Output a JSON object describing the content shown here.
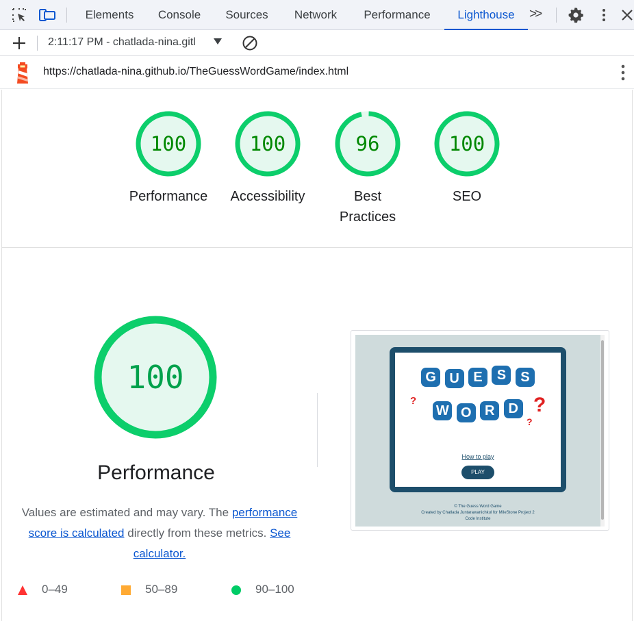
{
  "devtools": {
    "tabs": [
      {
        "label": "Elements"
      },
      {
        "label": "Console"
      },
      {
        "label": "Sources"
      },
      {
        "label": "Network"
      },
      {
        "label": "Performance"
      },
      {
        "label": "Lighthouse",
        "active": true
      }
    ],
    "more_tabs_label": ">>",
    "icons": [
      "inspect-element-icon",
      "device-toolbar-icon",
      "gear-icon",
      "kebab-menu-icon",
      "close-icon"
    ]
  },
  "toolbar": {
    "report_select": "2:11:17 PM - chatlada-nina.gitl",
    "icons": [
      "add-icon",
      "clear-icon"
    ]
  },
  "urlbar": {
    "url": "https://chatlada-nina.github.io/TheGuessWordGame/index.html",
    "icons": [
      "lighthouse-icon",
      "kebab-menu-icon"
    ]
  },
  "scores": [
    {
      "label": "Performance",
      "value": "100",
      "fraction": 1.0
    },
    {
      "label": "Accessibility",
      "value": "100",
      "fraction": 1.0
    },
    {
      "label": "Best Practices",
      "value": "96",
      "fraction": 0.96
    },
    {
      "label": "SEO",
      "value": "100",
      "fraction": 1.0
    }
  ],
  "performance": {
    "score": "100",
    "fraction": 1.0,
    "title": "Performance",
    "desc_prefix": "Values are estimated and may vary. The ",
    "link_score": "performance score is calculated",
    "desc_middle": " directly from these metrics. ",
    "link_calc": "See calculator."
  },
  "legend": [
    {
      "range": "0–49",
      "shape": "triangle",
      "color": "#ff3333"
    },
    {
      "range": "50–89",
      "shape": "square",
      "color": "#ffaa33"
    },
    {
      "range": "90–100",
      "shape": "circle",
      "color": "#00cc66"
    }
  ],
  "colors": {
    "pass": "#0cce6b",
    "pass_fill": "#e5f8ef",
    "pass_text": "#008800",
    "link": "#0b57d0"
  },
  "screenshot": {
    "tiles_row1": [
      "G",
      "U",
      "E",
      "S",
      "S"
    ],
    "tiles_row2": [
      "W",
      "O",
      "R",
      "D"
    ],
    "how_to_play": "How to play",
    "play": "PLAY",
    "footer": [
      "© The Guess Word Game",
      "Created by Chatlada Juntarawanichkul for MileStone Project 2",
      "Code Institute"
    ]
  }
}
